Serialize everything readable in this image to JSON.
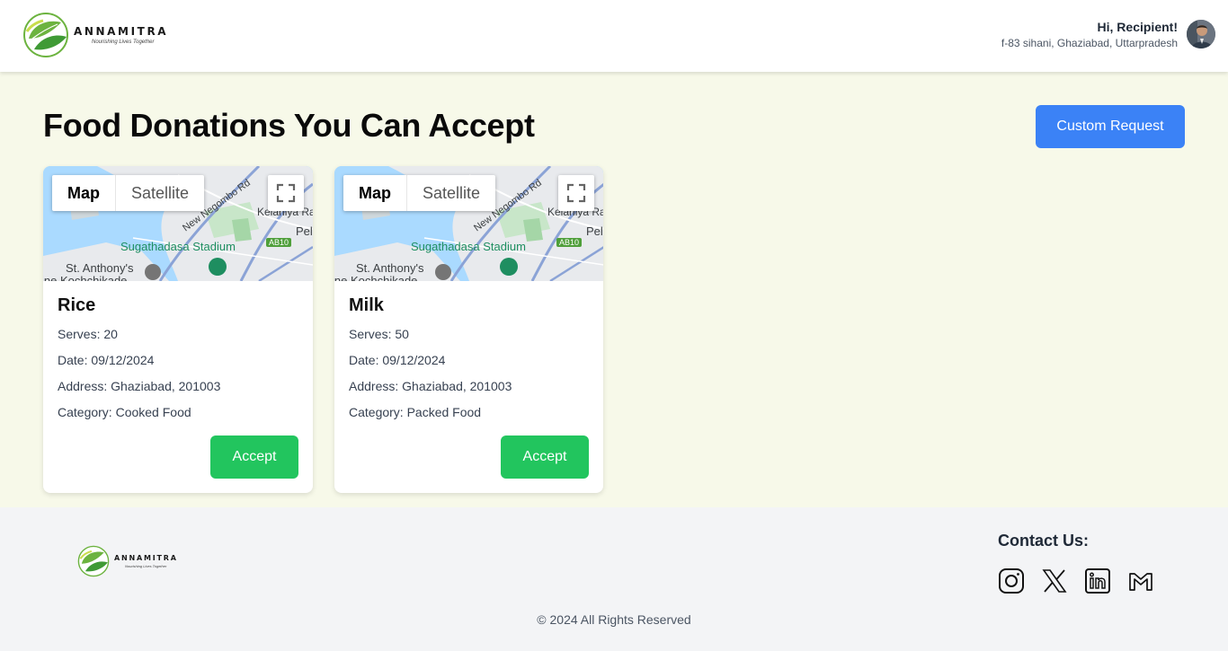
{
  "header": {
    "brand_name": "ANNAMITRA",
    "brand_tagline": "Nourishing Lives Together",
    "greeting": "Hi, Recipient!",
    "address": "f-83 sihani, Ghaziabad, Uttarpradesh"
  },
  "main": {
    "title": "Food Donations You Can Accept",
    "custom_request_label": "Custom Request",
    "map": {
      "map_label": "Map",
      "satellite_label": "Satellite",
      "places": {
        "road": "New Negombo Rd",
        "area_top": "Kelaniya Ra",
        "area_right": "Pel",
        "stadium": "Sugathadasa Stadium",
        "route": "AB10",
        "church": "St. Anthony's",
        "area_bottom": "ine Kochchikade"
      }
    },
    "donations": [
      {
        "name": "Rice",
        "serves": "Serves: 20",
        "date": "Date: 09/12/2024",
        "address": "Address: Ghaziabad, 201003",
        "category": "Category: Cooked Food",
        "accept_label": "Accept"
      },
      {
        "name": "Milk",
        "serves": "Serves: 50",
        "date": "Date: 09/12/2024",
        "address": "Address: Ghaziabad, 201003",
        "category": "Category: Packed Food",
        "accept_label": "Accept"
      }
    ]
  },
  "footer": {
    "brand_name": "ANNAMITRA",
    "brand_tagline": "Nourishing Lives Together",
    "contact_title": "Contact Us:",
    "socials": [
      "instagram-icon",
      "x-twitter-icon",
      "linkedin-icon",
      "gmail-icon"
    ],
    "copyright": "© 2024 All Rights Reserved"
  },
  "colors": {
    "page_bg": "#f7f9e9",
    "primary_blue": "#3b82f6",
    "accept_green": "#22c55e",
    "footer_bg": "#f3f4f6"
  }
}
